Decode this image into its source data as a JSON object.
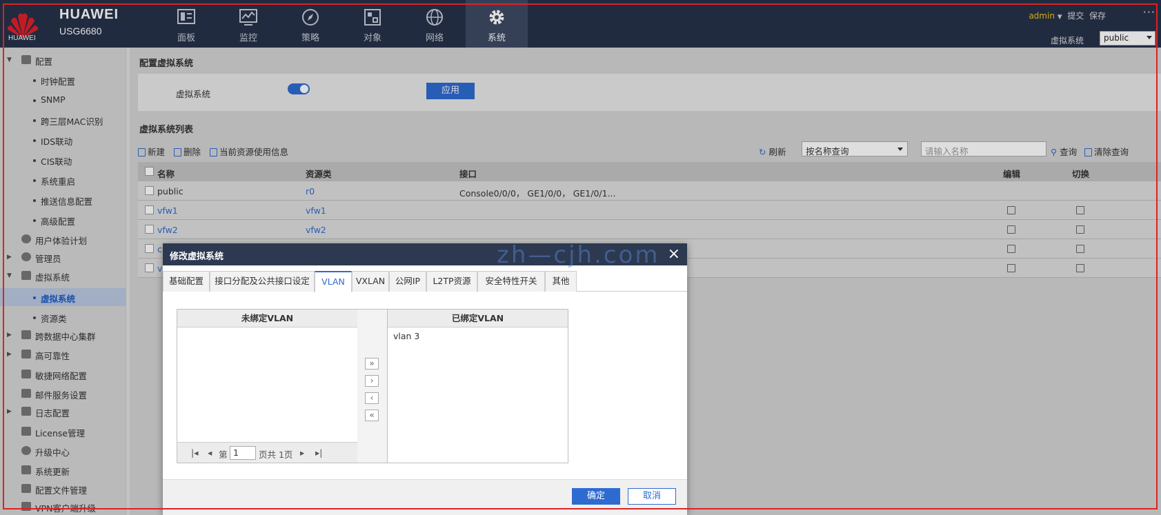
{
  "brand": {
    "name": "HUAWEI",
    "model": "USG6680",
    "logo_text": "HUAWEI"
  },
  "nav": [
    {
      "label": "面板",
      "icon": "dashboard-icon"
    },
    {
      "label": "监控",
      "icon": "monitor-icon"
    },
    {
      "label": "策略",
      "icon": "compass-icon"
    },
    {
      "label": "对象",
      "icon": "object-icon"
    },
    {
      "label": "网络",
      "icon": "globe-icon"
    },
    {
      "label": "系统",
      "icon": "gear-icon",
      "active": true
    }
  ],
  "topright": {
    "user": "admin",
    "submit": "提交",
    "save": "保存",
    "more": "···",
    "vsys_label": "虚拟系统",
    "vsys_value": "public"
  },
  "sidebar": {
    "items": [
      {
        "label": "配置",
        "type": "group",
        "expanded": true
      },
      {
        "label": "时钟配置",
        "type": "sub"
      },
      {
        "label": "SNMP",
        "type": "sub"
      },
      {
        "label": "跨三层MAC识别",
        "type": "sub"
      },
      {
        "label": "IDS联动",
        "type": "sub"
      },
      {
        "label": "CIS联动",
        "type": "sub"
      },
      {
        "label": "系统重启",
        "type": "sub"
      },
      {
        "label": "推送信息配置",
        "type": "sub"
      },
      {
        "label": "高级配置",
        "type": "sub"
      },
      {
        "label": "用户体验计划",
        "type": "item"
      },
      {
        "label": "管理员",
        "type": "group"
      },
      {
        "label": "虚拟系统",
        "type": "group",
        "expanded": true
      },
      {
        "label": "虚拟系统",
        "type": "sub",
        "selected": true
      },
      {
        "label": "资源类",
        "type": "sub"
      },
      {
        "label": "跨数据中心集群",
        "type": "group"
      },
      {
        "label": "高可靠性",
        "type": "group"
      },
      {
        "label": "敏捷网络配置",
        "type": "item"
      },
      {
        "label": "邮件服务设置",
        "type": "item"
      },
      {
        "label": "日志配置",
        "type": "group"
      },
      {
        "label": "License管理",
        "type": "item"
      },
      {
        "label": "升级中心",
        "type": "item"
      },
      {
        "label": "系统更新",
        "type": "item"
      },
      {
        "label": "配置文件管理",
        "type": "item"
      },
      {
        "label": "VPN客户端升级",
        "type": "item"
      }
    ]
  },
  "config_section": {
    "title": "配置虚拟系统",
    "label": "虚拟系统",
    "toggle_on": true,
    "apply": "应用"
  },
  "list_section": {
    "title": "虚拟系统列表",
    "toolbar": {
      "new": "新建",
      "delete": "删除",
      "usage": "当前资源使用信息",
      "refresh": "刷新",
      "search_mode": "按名称查询",
      "search_placeholder": "请输入名称",
      "query": "查询",
      "clear": "清除查询"
    },
    "columns": {
      "name": "名称",
      "resource": "资源类",
      "interface": "接口",
      "edit": "编辑",
      "switch": "切换"
    },
    "rows": [
      {
        "name": "public",
        "resource": "r0",
        "interface": "Console0/0/0， GE1/0/0， GE1/0/1..."
      },
      {
        "name": "vfw1",
        "resource": "vfw1",
        "interface": ""
      },
      {
        "name": "vfw2",
        "resource": "vfw2",
        "interface": ""
      },
      {
        "name": "c",
        "resource": "",
        "interface": ""
      },
      {
        "name": "v",
        "resource": "",
        "interface": ""
      }
    ]
  },
  "modal": {
    "title": "修改虚拟系统",
    "tabs": [
      "基础配置",
      "接口分配及公共接口设定",
      "VLAN",
      "VXLAN",
      "公网IP",
      "L2TP资源",
      "安全特性开关",
      "其他"
    ],
    "active_tab": "VLAN",
    "unbound_title": "未绑定VLAN",
    "bound_title": "已绑定VLAN",
    "bound_items": [
      "vlan 3"
    ],
    "pager": {
      "prefix": "第",
      "page": "1",
      "suffix": "页共 1页"
    },
    "move_buttons": [
      "»",
      "›",
      "‹",
      "«"
    ],
    "ok": "确定",
    "cancel": "取消"
  },
  "watermark": "zh—cjh.com"
}
